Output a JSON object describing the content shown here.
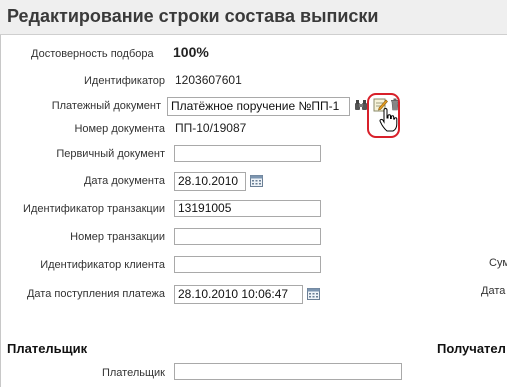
{
  "window": {
    "title": "Редактирование строки состава выписки"
  },
  "form": {
    "reliability": {
      "label": "Достоверность подбора",
      "value": "100%"
    },
    "identifier": {
      "label": "Идентификатор",
      "value": "1203607601"
    },
    "payment_document": {
      "label": "Платежный документ",
      "value": "Платёжное поручение №ПП-1"
    },
    "document_number": {
      "label": "Номер документа",
      "value": "ПП-10/19087"
    },
    "primary_document": {
      "label": "Первичный документ",
      "value": ""
    },
    "document_date": {
      "label": "Дата документа",
      "value": "28.10.2010"
    },
    "transaction_id": {
      "label": "Идентификатор транзакции",
      "value": "13191005"
    },
    "transaction_number": {
      "label": "Номер транзакции",
      "value": ""
    },
    "client_id": {
      "label": "Идентификатор клиента",
      "value": ""
    },
    "payment_receipt_date": {
      "label": "Дата поступления платежа",
      "value": "28.10.2010 10:06:47"
    }
  },
  "right_column": {
    "partial_label_1": "Сум",
    "partial_label_2": "Дата"
  },
  "sections": {
    "payer": {
      "title": "Плательщик",
      "field_label": "Плательщик",
      "field_value": ""
    },
    "recipient": {
      "title": "Получател"
    }
  },
  "icons": {
    "binoculars": "binoculars-icon",
    "edit": "edit-document-icon",
    "delete": "trash-icon",
    "calendar": "calendar-icon",
    "cursor": "hand-pointer-icon"
  },
  "colors": {
    "highlight": "#d8202a",
    "title_bg": "#efefef"
  }
}
